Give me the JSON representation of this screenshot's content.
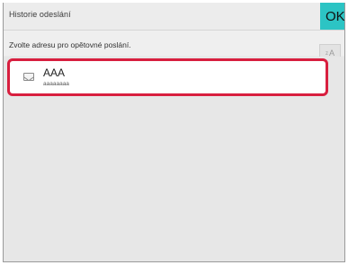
{
  "header": {
    "title": "Historie odeslání",
    "ok_label": "OK"
  },
  "subheader": {
    "instruction": "Zvolte adresu pro opětovné poslání.",
    "sort_icon": "sort-a-z-icon"
  },
  "history_list": {
    "items": [
      {
        "name": "AAA",
        "address": "aaaaaaaa",
        "icon": "email-icon",
        "selected": true
      }
    ]
  },
  "colors": {
    "ok_button": "#2cc4c4",
    "selection_border": "#d81f3f"
  }
}
